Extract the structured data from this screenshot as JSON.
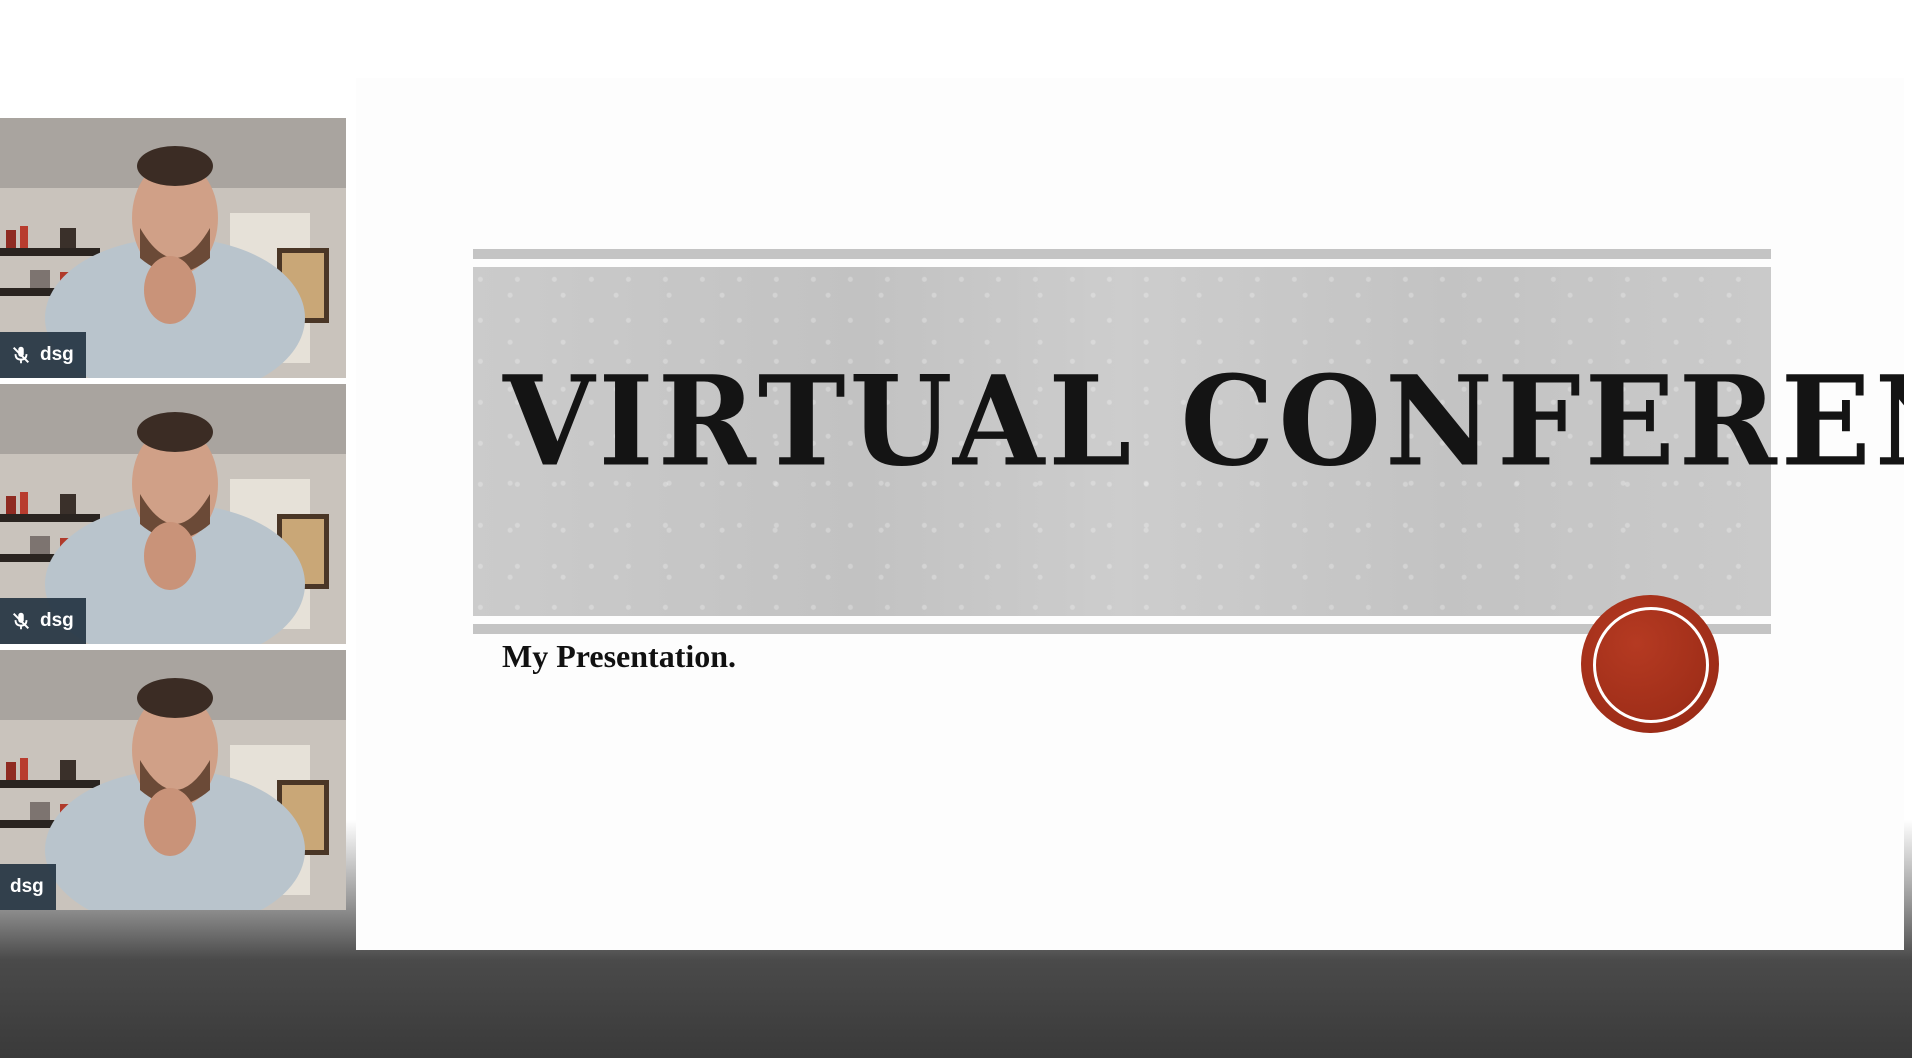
{
  "participants": [
    {
      "name": "dsg",
      "muted": true
    },
    {
      "name": "dsg",
      "muted": true
    },
    {
      "name": "dsg",
      "muted": false
    }
  ],
  "slide": {
    "title": "Virtual Conference",
    "subtitle": "My Presentation.",
    "accent_color": "#9e2d18",
    "band_color": "#c6c6c6"
  },
  "icons": {
    "muted": "mic-off-icon"
  }
}
